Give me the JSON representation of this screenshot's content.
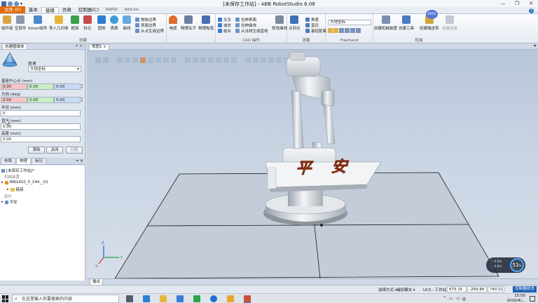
{
  "window": {
    "title": "[未保存工作站] - ABB RobotStudio 6.08",
    "controls": [
      "—",
      "❐",
      "✕"
    ]
  },
  "ribbon_tabs": [
    {
      "label": "文件 (F)",
      "kind": "file"
    },
    {
      "label": "基本",
      "kind": "normal"
    },
    {
      "label": "建模",
      "kind": "active"
    },
    {
      "label": "仿真",
      "kind": "normal"
    },
    {
      "label": "控制器(C)",
      "kind": "normal"
    },
    {
      "label": "RAPID",
      "kind": "small"
    },
    {
      "label": "Add-Ins",
      "kind": "small"
    }
  ],
  "ribbon": {
    "create_group": {
      "label": "创建",
      "buttons": [
        "组件组",
        "空部件",
        "Smart组件",
        "导入几何体",
        "框架",
        "标记",
        "固体",
        "表面",
        "曲线"
      ],
      "small": [
        "物体边界",
        "表面边界",
        "从点生成边界"
      ]
    },
    "cad_group": {
      "label": "CAD 操作",
      "buttons": [
        "拉伸表面",
        "拉伸曲线",
        "从法线生成直线",
        "修改曲线"
      ],
      "small": [
        "交叉",
        "减去",
        "结合"
      ]
    },
    "mechanism_extra": {
      "buttons": [
        "电缆",
        "物理关节",
        "物理拖曳"
      ]
    },
    "measure_group": {
      "label": "测量",
      "buttons": [
        "点到点"
      ],
      "small": [
        "角度",
        "直径",
        "最短距离"
      ]
    },
    "freehand_group": {
      "label": "Freehand",
      "select_value": "大地坐标"
    },
    "machine_group": {
      "label": "机械",
      "buttons": [
        "创建机械装置",
        "创建工具",
        "创建输送带",
        "创建连接"
      ]
    },
    "badge": "8652"
  },
  "left_panel": {
    "title": "创建圆锥体",
    "reference_label": "参考",
    "reference_value": "大地坐标",
    "base_center_label": "基座中心点 (mm)",
    "base_center": [
      "0.00",
      "0.00",
      "0.00"
    ],
    "orientation_label": "方向 (deg)",
    "orientation": [
      "0.00",
      "0.00",
      "0.00"
    ],
    "radius_label": "半径 (mm)",
    "radius_value": "0",
    "diameter_label": "直径 (mm)",
    "diameter_value": "0.00",
    "height_label": "高度 (mm)",
    "height_value": "0.00",
    "buttons": {
      "clear": "清除",
      "close": "关闭",
      "create": "创建"
    }
  },
  "browser": {
    "tabs": [
      "布局",
      "物理",
      "标记"
    ],
    "rows": [
      {
        "text": "[未保存工作站]*",
        "grey": false
      },
      {
        "text": "机械装置",
        "grey": true
      },
      {
        "text": "IRB1410_5_144__01",
        "grey": false
      },
      {
        "text": "链接",
        "grey": false
      },
      {
        "text": "部件",
        "grey": true
      },
      {
        "text": "平安",
        "grey": false
      }
    ]
  },
  "view": {
    "tab_label": "视图1",
    "watermark": "平安",
    "cpu_percent": "51",
    "net_up": "0 K/s",
    "net_down": "0 K/s"
  },
  "output": {
    "label": "输出"
  },
  "statusbar": {
    "select_mode": "选择方式",
    "capture_mode": "捕捉模式",
    "ucs_label": "UCS : 工作站",
    "x": "879.16",
    "y": "-269.88",
    "z": "740.01",
    "controller_status": "控制器状态"
  },
  "taskbar": {
    "search_placeholder": "在这里输入你要搜索的内容",
    "time": "15:50",
    "date": "2020/4/..."
  },
  "colors": {
    "file_tab": "#e36c09",
    "viewport_top": "#b8c6da",
    "field_red": "#f6c4c4",
    "field_green": "#c8efc4",
    "field_blue": "#c8dcf5",
    "text_3d": "#c0441c"
  }
}
